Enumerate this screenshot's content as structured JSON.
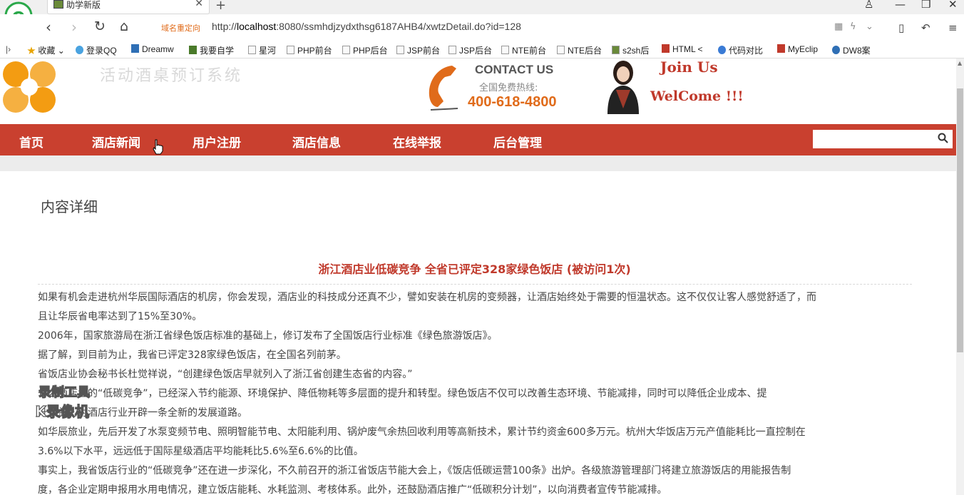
{
  "browser": {
    "tab_title": "助学新版",
    "redirect_label": "域名重定向",
    "url_prefix": "http://",
    "url_host": "localhost",
    "url_rest": ":8080/ssmhdjzydxthsg6187AHB4/xwtzDetail.do?id=128"
  },
  "bookmarks": [
    "收藏",
    "登录QQ",
    "Dreamw",
    "我要自学",
    "星河",
    "PHP前台",
    "PHP后台",
    "JSP前台",
    "JSP后台",
    "NTE前台",
    "NTE后台",
    "s2sh后",
    "HTML <",
    "代码对比",
    "MyEclip",
    "DW8案"
  ],
  "header": {
    "site_title": "活动酒桌预订系统",
    "contact": "CONTACT US",
    "hotline_label": "全国免费热线:",
    "hotline": "400-618-4800",
    "join": "Join Us",
    "welcome": "WelCome !!!"
  },
  "nav": [
    "首页",
    "酒店新闻",
    "用户注册",
    "酒店信息",
    "在线举报",
    "后台管理"
  ],
  "section_title": "内容详细",
  "article": {
    "title": "浙江酒店业低碳竞争 全省已评定328家绿色饭店 (被访问1次)",
    "lines": [
      "  如果有机会走进杭州华辰国际酒店的机房，你会发现，酒店业的科技成分还真不少，譬如安装在机房的变频器，让酒店始终处于需要的恒温状态。这不仅仅让客人感觉舒适了，而",
      "且让华辰省电率达到了15%至30%。",
      "        2006年，国家旅游局在浙江省绿色饭店标准的基础上，修订发布了全国饭店行业标准《绿色旅游饭店》。",
      "据了解，到目前为止，我省已评定328家绿色饭店，在全国名列前茅。",
      "        省饭店业协会秘书长杜觉祥说，“创建绿色饭店早就列入了浙江省创建生态省的内容。”",
      "        省内酒店业的“低碳竞争”，已经深入节约能源、环境保护、降低物耗等多层面的提升和转型。绿色饭店不仅可以改善生态环境、节能减排，同时可以降低企业成本、提",
      "升效益，为酒店行业开辟一条全新的发展道路。",
      "        如华辰旅业，先后开发了水泵变频节电、照明智能节电、太阳能利用、锅炉废气余热回收利用等高新技术，累计节约资金600多万元。杭州大华饭店万元产值能耗比一直控制在",
      "3.6%以下水平，远远低于国际星级酒店平均能耗比5.6%至6.6%的比值。",
      "        事实上，我省饭店行业的“低碳竞争”还在进一步深化，不久前召开的浙江省饭店节能大会上，《饭店低碳运营100条》出炉。各级旅游管理部门将建立旅游饭店的用能报告制",
      "度，各企业定期申报用水用电情况，建立饭店能耗、水耗监测、考核体系。此外，还鼓励酒店推广“低碳积分计划”，以向消费者宣传节能减排。"
    ]
  },
  "watermark": {
    "line1": "录制工具",
    "line2": "KK录像机"
  },
  "colors": {
    "nav_bg": "#c9402f",
    "title_red": "#c0392b",
    "hotline_orange": "#e06b1a"
  }
}
